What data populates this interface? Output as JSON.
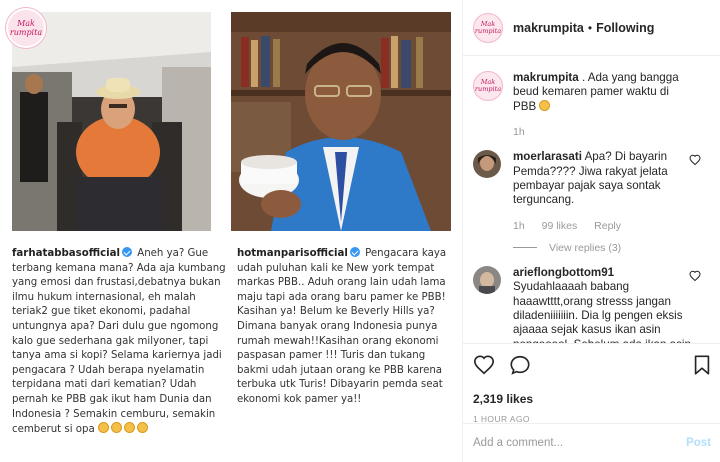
{
  "post": {
    "left_panel": {
      "logo_text": "Mak rumpita",
      "caption_user": "farhatabbasofficial",
      "caption_text": "Aneh ya? Gue terbang kemana mana? Ada aja kumbang yang emosi dan frustasi,debatnya bukan ilmu hukum internasional, eh malah teriak2 gue tiket ekonomi, padahal untungnya apa? Dari dulu gue ngomong kalo gue sederhana gak milyoner, tapi tanya ama si kopi? Selama kariernya jadi pengacara ? Udah berapa nyelamatin terpidana mati dari kematian? Udah pernah ke PBB gak ikut ham Dunia dan Indonesia ? Semakin cemburu, semakin cemberut si opa"
    },
    "right_panel": {
      "caption_user": "hotmanparisofficial",
      "caption_text": "Pengacara kaya udah puluhan kali ke New york tempat markas PBB.. Aduh orang lain udah lama maju tapi ada orang baru pamer ke PBB! Kasihan ya! Belum ke Beverly Hills ya? Dimana banyak orang Indonesia punya rumah mewah!!Kasihan orang ekonomi paspasan pamer !!! Turis dan tukang bakmi udah jutaan orang ke PBB karena terbuka utk Turis! Dibayarin pemda seat ekonomi kok pamer ya!!"
    }
  },
  "header": {
    "username": "makrumpita",
    "separator": "•",
    "follow_status": "Following",
    "avatar_text": "Mak rumpita"
  },
  "comments": [
    {
      "username": "makrumpita",
      "text": ". Ada yang bangga beud kemaren pamer waktu di PBB",
      "time": "1h"
    },
    {
      "username": "moerlarasati",
      "text": "Apa? Di bayarin Pemda???? Jiwa rakyat jelata pembayar pajak saya sontak terguncang.",
      "time": "1h",
      "likes": "99 likes",
      "reply": "Reply",
      "view_replies": "View replies (3)"
    },
    {
      "username": "arieflongbottom91",
      "text": "Syudahlaaaah babang haaawtttt,orang stresss jangan diladeniiiiiiin. Dia lg pengen eksis ajaaaa sejak kasus ikan asin nongooool. Sebelum ada ikan asin kan dia ngilaaang"
    }
  ],
  "actions": {
    "likes": "2,319 likes",
    "time": "1 HOUR AGO"
  },
  "add_comment": {
    "placeholder": "Add a comment...",
    "post_label": "Post"
  },
  "colors": {
    "verified": "#3897f0",
    "post_disabled": "#b2dffc",
    "border": "#efefef"
  }
}
